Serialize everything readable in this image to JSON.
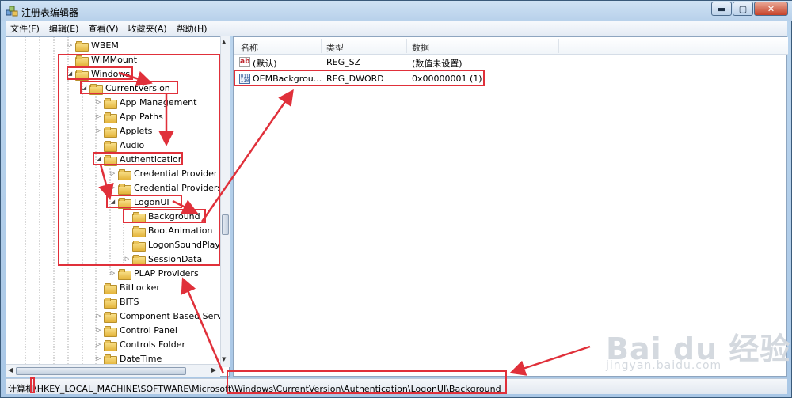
{
  "window": {
    "title": "注册表编辑器"
  },
  "window_buttons": {
    "minimize": "▬",
    "maximize": "▢",
    "close": "✕"
  },
  "menu": [
    "文件(F)",
    "编辑(E)",
    "查看(V)",
    "收藏夹(A)",
    "帮助(H)"
  ],
  "tree": [
    {
      "label": "WBEM",
      "level": 0,
      "exp": "▷"
    },
    {
      "label": "WIMMount",
      "level": 0,
      "exp": ""
    },
    {
      "label": "Windows",
      "level": 0,
      "exp": "◢"
    },
    {
      "label": "CurrentVersion",
      "level": 1,
      "exp": "◢"
    },
    {
      "label": "App Management",
      "level": 2,
      "exp": "▷"
    },
    {
      "label": "App Paths",
      "level": 2,
      "exp": "▷"
    },
    {
      "label": "Applets",
      "level": 2,
      "exp": "▷"
    },
    {
      "label": "Audio",
      "level": 2,
      "exp": ""
    },
    {
      "label": "Authentication",
      "level": 2,
      "exp": "◢"
    },
    {
      "label": "Credential Provider",
      "level": 3,
      "exp": "▷"
    },
    {
      "label": "Credential Providers",
      "level": 3,
      "exp": "▷"
    },
    {
      "label": "LogonUI",
      "level": 3,
      "exp": "◢"
    },
    {
      "label": "Background",
      "level": 4,
      "exp": ""
    },
    {
      "label": "BootAnimation",
      "level": 4,
      "exp": ""
    },
    {
      "label": "LogonSoundPlay",
      "level": 4,
      "exp": ""
    },
    {
      "label": "SessionData",
      "level": 4,
      "exp": "▷"
    },
    {
      "label": "PLAP Providers",
      "level": 3,
      "exp": "▷"
    },
    {
      "label": "BitLocker",
      "level": 2,
      "exp": ""
    },
    {
      "label": "BITS",
      "level": 2,
      "exp": ""
    },
    {
      "label": "Component Based Serv",
      "level": 2,
      "exp": "▷"
    },
    {
      "label": "Control Panel",
      "level": 2,
      "exp": "▷"
    },
    {
      "label": "Controls Folder",
      "level": 2,
      "exp": "▷"
    },
    {
      "label": "DateTime",
      "level": 2,
      "exp": "▷"
    }
  ],
  "list": {
    "headers": {
      "name": "名称",
      "type": "类型",
      "data": "数据"
    },
    "rows": [
      {
        "icon": "string-value-icon",
        "icon_text": "ab",
        "name": "(默认)",
        "type": "REG_SZ",
        "data": "(数值未设置)"
      },
      {
        "icon": "dword-value-icon",
        "icon_text": "011 110",
        "name": "OEMBackgrou...",
        "type": "REG_DWORD",
        "data": "0x00000001 (1)"
      }
    ]
  },
  "status": {
    "path": "计算机\\HKEY_LOCAL_MACHINE\\SOFTWARE\\Microsoft\\Windows\\CurrentVersion\\Authentication\\LogonUI\\Background"
  },
  "watermark": {
    "main": "Bai du 经验",
    "sub": "jingyan.baidu.com"
  },
  "colors": {
    "annotation": "#e0303a",
    "window_frame": "#b7d0ea"
  }
}
